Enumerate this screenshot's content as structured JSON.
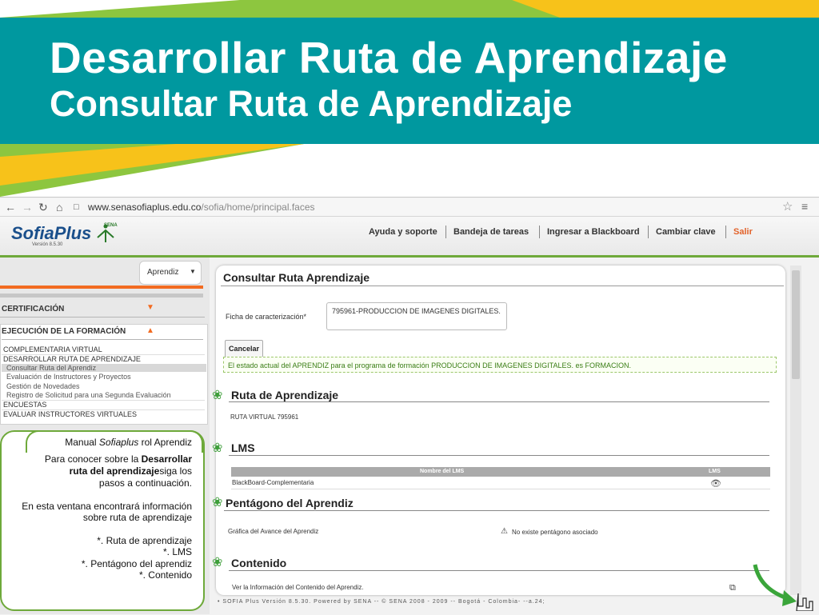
{
  "slide": {
    "title_line1": "Desarrollar Ruta de Aprendizaje",
    "title_line2": "Consultar Ruta de Aprendizaje",
    "band_color": "#00989f",
    "accent_green": "#8dc63f",
    "accent_yellow": "#f7c21a"
  },
  "browser": {
    "url_host": "www.senasofiaplus.edu.co",
    "url_path": "/sofia/home/principal.faces",
    "icons": [
      "back-icon",
      "forward-icon",
      "reload-icon",
      "home-icon",
      "page-icon",
      "star-icon",
      "menu-icon"
    ]
  },
  "app": {
    "logo": "SofiaPlus",
    "logo_version": "Versión 8.5.30",
    "sena_logo": "SENA",
    "nav": [
      "Ayuda y soporte",
      "Bandeja de tareas",
      "Ingresar a Blackboard",
      "Cambiar clave",
      "Salir"
    ]
  },
  "sidebar": {
    "role": "Aprendiz",
    "sections": [
      {
        "label": "CERTIFICACIÓN"
      },
      {
        "label": "EJECUCIÓN DE LA FORMACIÓN"
      }
    ],
    "menu": [
      "COMPLEMENTARIA VIRTUAL",
      "DESARROLLAR RUTA DE APRENDIZAJE",
      "Consultar Ruta del Aprendiz",
      "Evaluación de Instructores y Proyectos",
      "Gestión de Novedades",
      "Registro de Solicitud para una Segunda Evaluación",
      "ENCUESTAS",
      "EVALUAR INSTRUCTORES VIRTUALES"
    ]
  },
  "help": {
    "title_prefix": "Manual ",
    "title_italic": "Sofiaplus",
    "title_suffix": " rol Aprendiz",
    "p1_l1a": "Para conocer sobre la ",
    "p1_l1b": "Desarrollar",
    "p1_l2a": "ruta del aprendizaje",
    "p1_l2b": "siga los",
    "p1_l3": "pasos a continuación.",
    "p2_l1": "En esta ventana encontrará información",
    "p2_l2": "sobre ruta de aprendizaje",
    "items": [
      "*. Ruta de aprendizaje",
      "*. LMS",
      "*. Pentágono del aprendiz",
      "*. Contenido"
    ]
  },
  "main": {
    "title": "Consultar Ruta Aprendizaje",
    "ficha_label": "Ficha de caracterización*",
    "ficha_value": "795961-PRODUCCION DE IMAGENES DIGITALES.",
    "cancel": "Cancelar",
    "status": "El estado actual del APRENDIZ para el programa de formación PRODUCCION DE IMAGENES DIGITALES. es FORMACION.",
    "ruta_head": "Ruta de Aprendizaje",
    "ruta_value": "RUTA VIRTUAL 795961",
    "lms_head": "LMS",
    "lms_col1": "Nombre del LMS",
    "lms_col2": "LMS",
    "lms_row": "BlackBoard-Complementaria",
    "pent_head": "Pentágono del Aprendiz",
    "pent_label": "Gráfica del Avance del Aprendiz",
    "pent_value": "No existe pentágono asociado",
    "cont_head": "Contenido",
    "cont_label": "Ver la Información del Contenido del Aprendiz."
  },
  "footer": "• SOFIA Plus Versión 8.5.30. Powered by SENA -- © SENA 2008 - 2009 -- Bogotá - Colombia- --a.24;"
}
